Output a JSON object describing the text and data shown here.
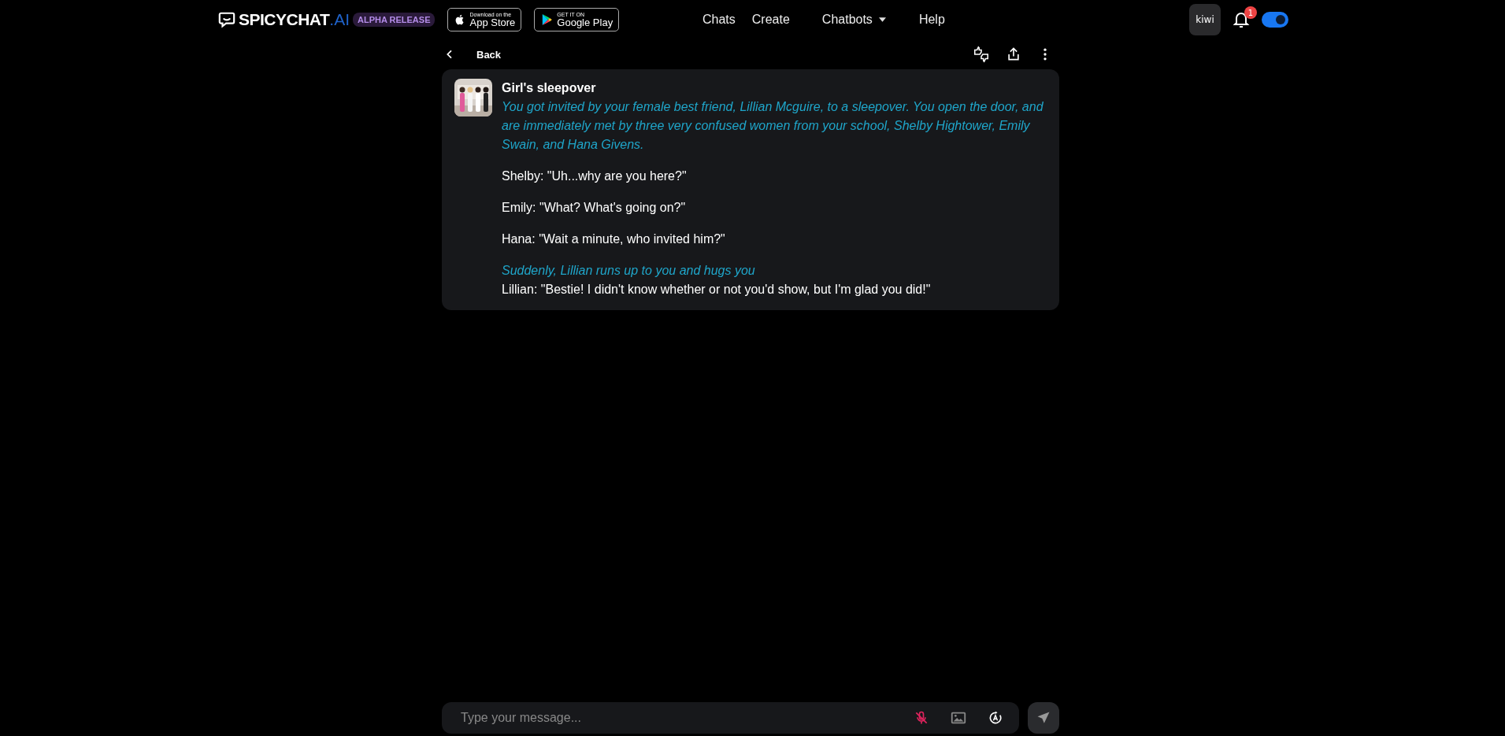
{
  "header": {
    "logo": "SPICYCHAT",
    "logo_suffix": ".AI",
    "badge": "ALPHA RELEASE",
    "stores": [
      {
        "small": "Download on the",
        "big": "App Store",
        "kind": "apple"
      },
      {
        "small": "GET IT ON",
        "big": "Google Play",
        "kind": "google"
      }
    ],
    "nav": [
      {
        "label": "Chats",
        "dropdown": false
      },
      {
        "label": "Create",
        "dropdown": false
      },
      {
        "label": "Chatbots",
        "dropdown": true
      },
      {
        "label": "Help",
        "dropdown": false
      }
    ],
    "user": "kiwi",
    "notifications": "1",
    "toggle": {
      "on": true
    }
  },
  "back": "Back",
  "message": {
    "name": "Girl's sleepover",
    "paragraphs": [
      [
        {
          "kind": "narration",
          "text": "You got invited by your female best friend, Lillian Mcguire, to a sleepover. You open the door, and are immediately met by three very confused women from your school, Shelby Hightower, Emily Swain, and Hana Givens."
        }
      ],
      [
        {
          "kind": "dialogue",
          "text": "Shelby: \"Uh...why are you here?\""
        }
      ],
      [
        {
          "kind": "dialogue",
          "text": "Emily: \"What? What's going on?\""
        }
      ],
      [
        {
          "kind": "dialogue",
          "text": "Hana: \"Wait a minute, who invited him?\""
        }
      ],
      [
        {
          "kind": "narration",
          "text": "Suddenly, Lillian runs up to you and hugs you"
        },
        {
          "kind": "dialogue",
          "text": "Lillian: \"Bestie! I didn't know whether or not you'd show, but I'm glad you did!\""
        }
      ]
    ]
  },
  "composer": {
    "placeholder": "Type your message...",
    "mic_muted": true
  }
}
